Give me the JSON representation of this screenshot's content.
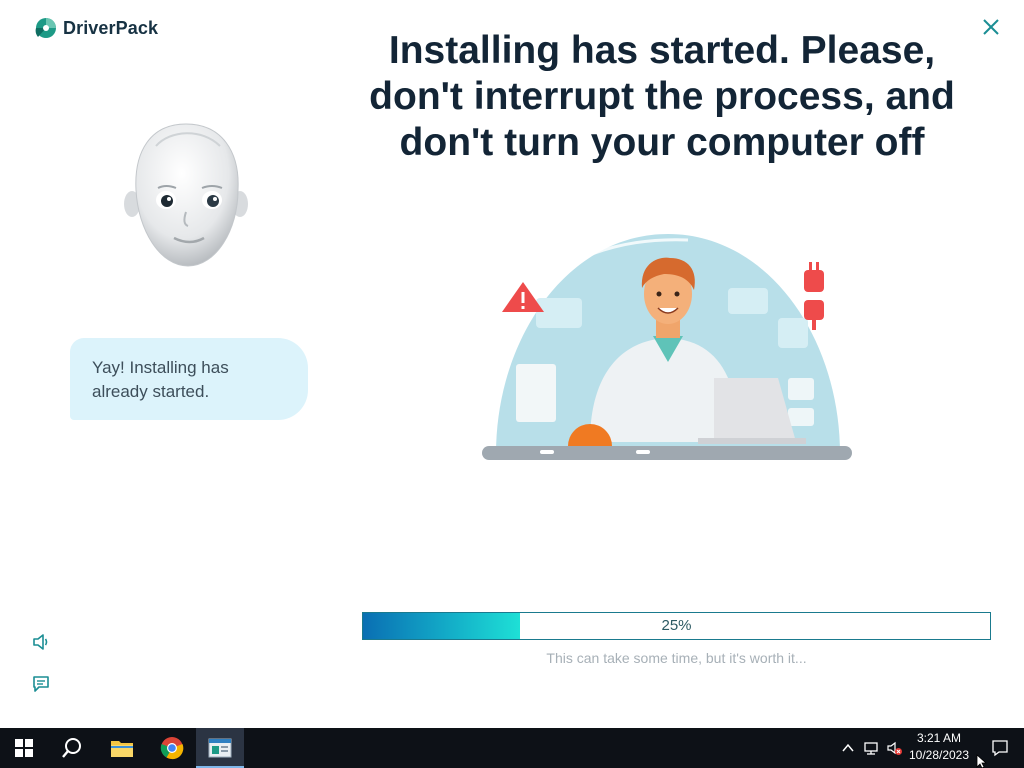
{
  "brand": {
    "name": "DriverPack"
  },
  "headline": {
    "line1": "Installing has started. Please,",
    "line2": "don't interrupt the process, and",
    "line3": "don't turn your computer off"
  },
  "assistant": {
    "message_line1": "Yay! Installing has",
    "message_line2": "already started."
  },
  "progress": {
    "percent": 25,
    "label": "25%",
    "hint": "This can take some time, but it's worth it..."
  },
  "taskbar": {
    "apps": [
      {
        "name": "start",
        "icon": "windows-icon"
      },
      {
        "name": "search",
        "icon": "search-icon"
      },
      {
        "name": "file-explorer",
        "icon": "folder-icon"
      },
      {
        "name": "chrome",
        "icon": "chrome-icon"
      },
      {
        "name": "driverpack",
        "icon": "app-window-icon"
      }
    ],
    "clock": {
      "time": "3:21 AM",
      "date": "10/28/2023"
    }
  },
  "colors": {
    "accent": "#0e8fc4",
    "progress_start": "#0a6fb3",
    "progress_end": "#1ee0d6",
    "bubble": "#dcf3fb",
    "brand_green": "#1d9a86",
    "heading": "#132536"
  }
}
